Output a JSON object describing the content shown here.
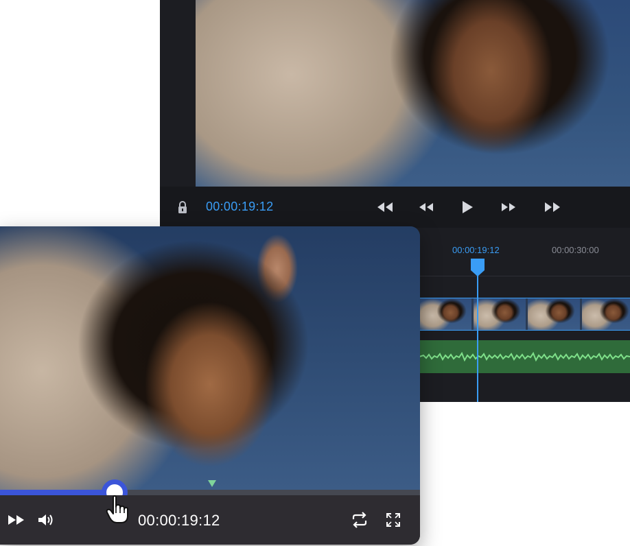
{
  "editor": {
    "time": "00:00:19:12",
    "controls": {
      "lock_icon": "lock-icon",
      "buttons": [
        "skip-to-start-icon",
        "rewind-icon",
        "play-icon",
        "fast-forward-icon",
        "skip-to-end-icon"
      ]
    },
    "timeline": {
      "timecodes": [
        "00:00:19:12",
        "00:00:30:00"
      ],
      "accent": "#3a9df5",
      "audio_color": "#2f6b3a"
    }
  },
  "player": {
    "time": "00:00:19:12",
    "progress": 0.27,
    "accent": "#3b55d9",
    "buttons": [
      "fast-forward-icon",
      "volume-icon",
      "loop-icon",
      "fullscreen-icon"
    ]
  }
}
